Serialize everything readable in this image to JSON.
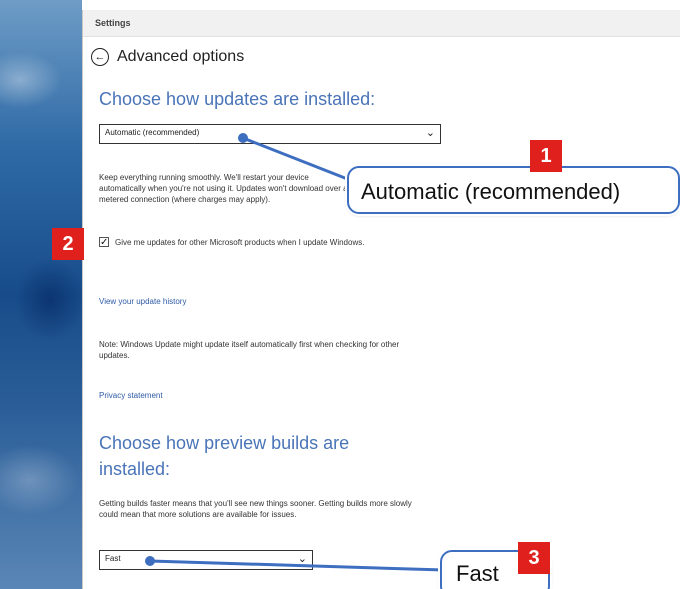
{
  "window": {
    "title": "Settings"
  },
  "header": {
    "title": "Advanced options"
  },
  "updates": {
    "heading": "Choose how updates are installed:",
    "dropdown_value": "Automatic (recommended)",
    "description": "Keep everything running smoothly. We'll restart your device automatically when you're not using it. Updates won't download over a metered connection (where charges may apply).",
    "checkbox_label": "Give me updates for other Microsoft products when I update Windows.",
    "checkbox_checked": true,
    "history_link": "View your update history",
    "note": "Note: Windows Update might update itself automatically first when checking for other updates.",
    "privacy_link": "Privacy statement"
  },
  "preview": {
    "heading_line1": "Choose how preview builds are",
    "heading_line2": "installed:",
    "description": "Getting builds faster means that you'll see new things sooner. Getting builds more slowly could mean that more solutions are available for issues.",
    "dropdown_value": "Fast"
  },
  "annotations": {
    "badge1": "1",
    "badge2": "2",
    "badge3": "3",
    "callout1": "Automatic (recommended)",
    "callout3": "Fast",
    "accent_color": "#3d6ec0",
    "badge_color": "#e0201d"
  }
}
